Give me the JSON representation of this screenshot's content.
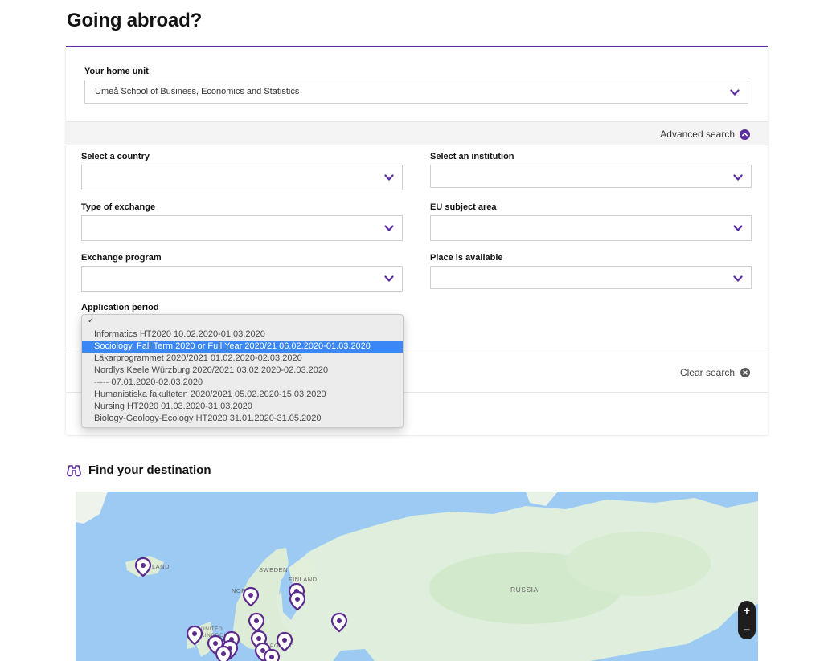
{
  "page": {
    "title": "Going abroad?"
  },
  "home_unit": {
    "label": "Your home unit",
    "value": "Umeå School of Business, Economics and Statistics"
  },
  "advanced": {
    "label": "Advanced search"
  },
  "filters": {
    "country": {
      "label": "Select a country",
      "value": ""
    },
    "institution": {
      "label": "Select an institution",
      "value": ""
    },
    "exchange_type": {
      "label": "Type of exchange",
      "value": ""
    },
    "eu_subject": {
      "label": "EU subject area",
      "value": ""
    },
    "program": {
      "label": "Exchange program",
      "value": ""
    },
    "place_available": {
      "label": "Place is available",
      "value": ""
    },
    "application_period": {
      "label": "Application period"
    }
  },
  "dropdown": {
    "check": "✓",
    "options": [
      "Informatics HT2020 10.02.2020-01.03.2020",
      "Sociology, Fall Term 2020 or Full Year 2020/21 06.02.2020-01.03.2020",
      "Läkarprogrammet 2020/2021 01.02.2020-02.03.2020",
      "Nordlys Keele Würzburg 2020/2021 03.02.2020-02.03.2020",
      "----- 07.01.2020-02.03.2020",
      "Humanistiska fakulteten 2020/2021 05.02.2020-15.03.2020",
      "Nursing HT2020 01.03.2020-31.03.2020",
      "Biology-Geology-Ecology HT2020 31.01.2020-31.05.2020"
    ],
    "selected_index": 1
  },
  "clear": {
    "label": "Clear search"
  },
  "find": {
    "title": "Find your destination",
    "icon": "binoculars-icon"
  },
  "map": {
    "labels": {
      "sweden": "SWEDEN",
      "finland": "FINLAND",
      "russia": "RUSSIA",
      "iceland": "LAND",
      "norway": "NOR",
      "uk": "UNITED KINGDOM",
      "poland": "POLAND"
    },
    "zoom_in": "+",
    "zoom_out": "−"
  },
  "colors": {
    "accent": "#5a2ca0",
    "water": "#9ccaf2",
    "land": "#dfeedd",
    "pin": "#5b2a8c",
    "selected": "#3b87f5"
  }
}
